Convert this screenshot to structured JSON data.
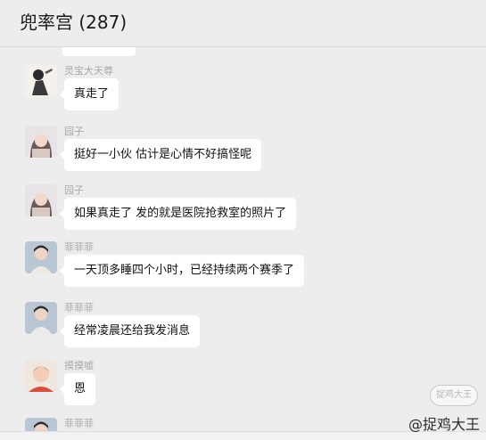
{
  "header": {
    "title": "兜率宫 (287)"
  },
  "messages": [
    {
      "sender": "灵宝大天尊",
      "text": "真走了"
    },
    {
      "sender": "园子",
      "text": "挺好一小伙 估计是心情不好搞怪呢"
    },
    {
      "sender": "园子",
      "text": "如果真走了 发的就是医院抢救室的照片了"
    },
    {
      "sender": "菲菲菲",
      "text": "一天顶多睡四个小时，已经持续两个赛季了"
    },
    {
      "sender": "菲菲菲",
      "text": "经常凌晨还给我发消息"
    },
    {
      "sender": "摸摸嘘",
      "text": "恩"
    },
    {
      "sender": "菲菲菲",
      "text": ""
    }
  ],
  "watermark": {
    "handle": "@捉鸡大王",
    "badge": "捉鸡大王"
  },
  "colors": {
    "background": "#ededed",
    "bubble": "#ffffff",
    "sender_name": "#a8a8a8"
  }
}
